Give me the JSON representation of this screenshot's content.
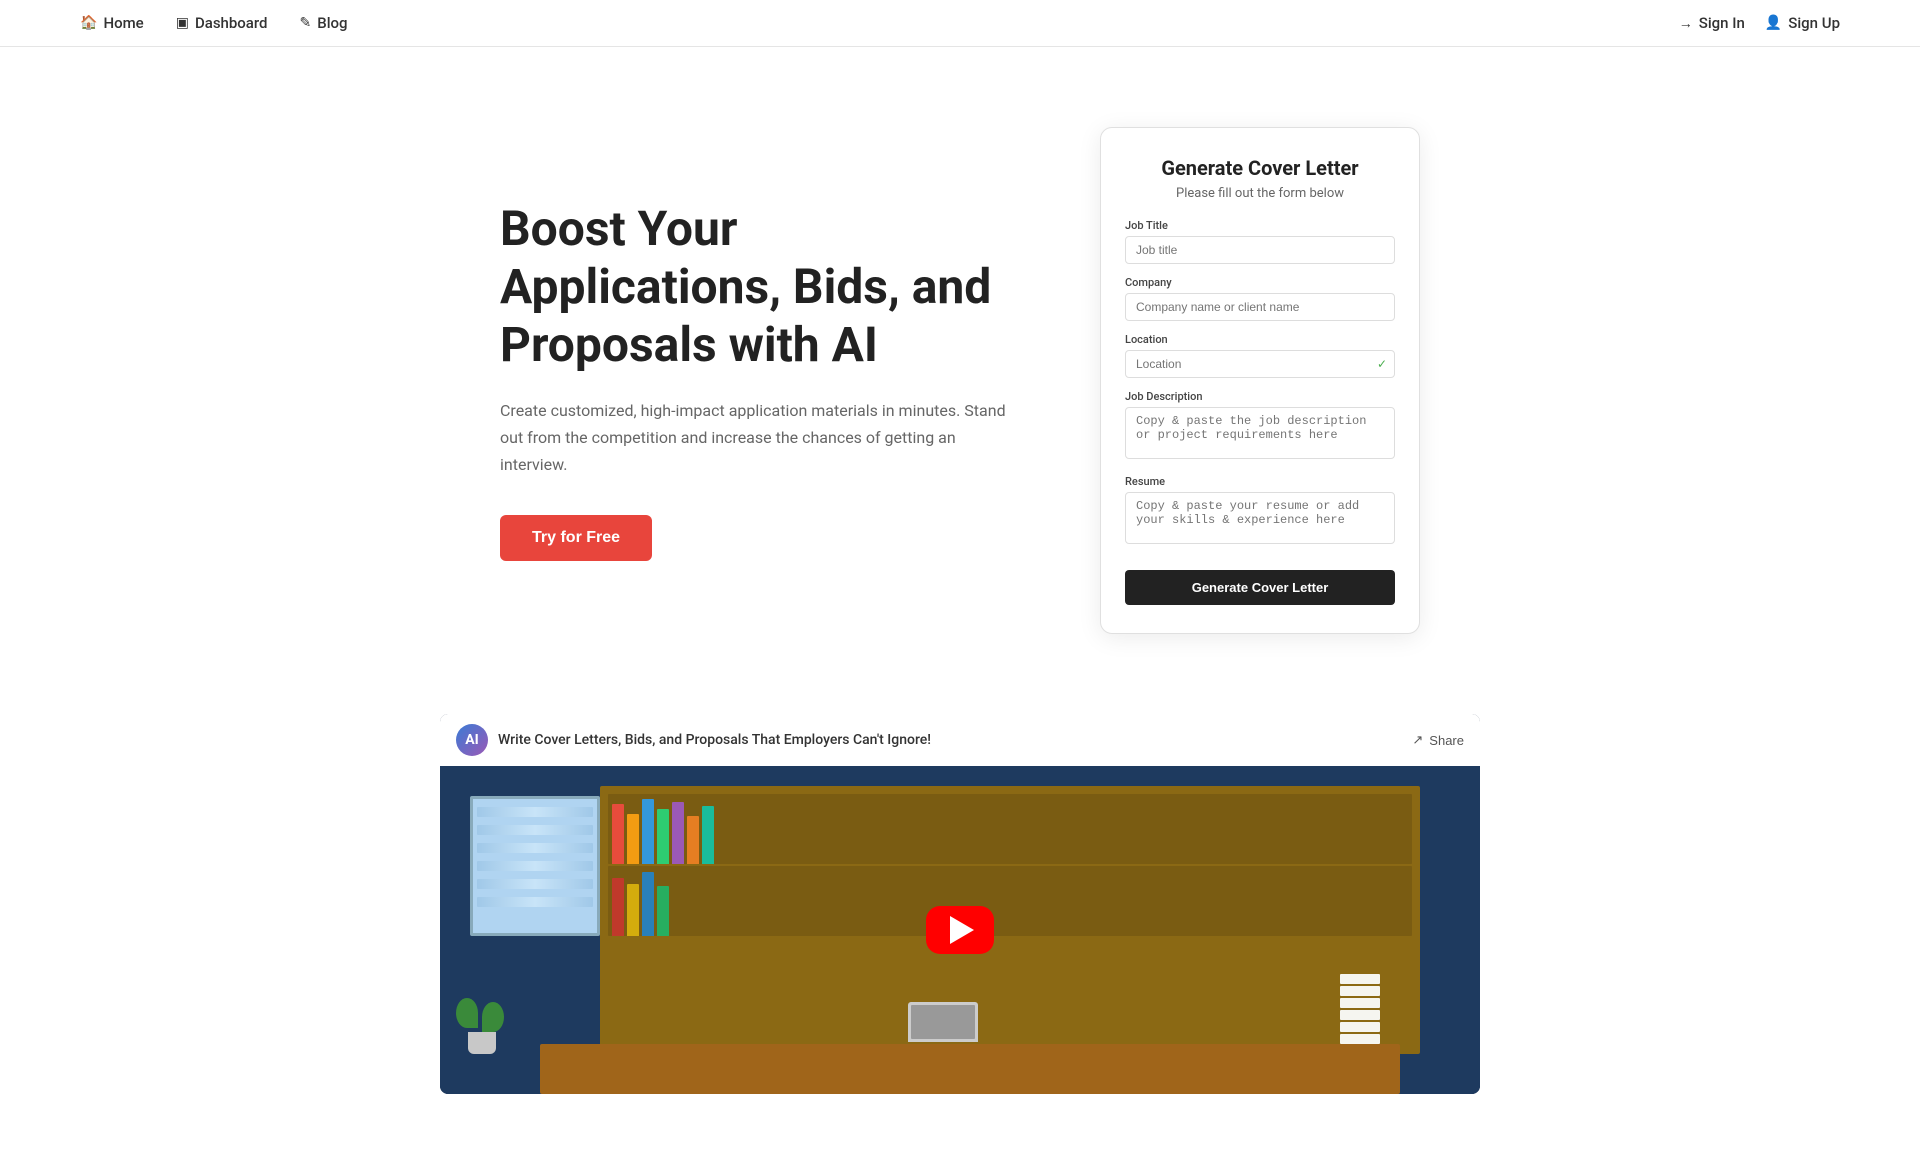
{
  "nav": {
    "links": [
      {
        "id": "home",
        "icon": "🏠",
        "label": "Home"
      },
      {
        "id": "dashboard",
        "icon": "▣",
        "label": "Dashboard"
      },
      {
        "id": "blog",
        "icon": "✎",
        "label": "Blog"
      }
    ],
    "auth": [
      {
        "id": "signin",
        "icon": "→",
        "label": "Sign In"
      },
      {
        "id": "signup",
        "icon": "👤",
        "label": "Sign Up"
      }
    ]
  },
  "hero": {
    "title": "Boost Your Applications, Bids, and Proposals with AI",
    "subtitle": "Create customized, high-impact application materials in minutes. Stand out from the competition and increase the chances of getting an interview.",
    "cta_label": "Try for Free"
  },
  "form_card": {
    "title": "Generate Cover Letter",
    "subtitle": "Please fill out the form below",
    "fields": [
      {
        "id": "job-title",
        "label": "Job Title",
        "placeholder": "Job title",
        "type": "input"
      },
      {
        "id": "company",
        "label": "Company",
        "placeholder": "Company name or client name",
        "type": "input"
      },
      {
        "id": "location",
        "label": "Location",
        "placeholder": "Location",
        "type": "input",
        "has_icon": true
      },
      {
        "id": "job-description",
        "label": "Job Description",
        "placeholder": "Copy & paste the job description or project requirements here",
        "type": "textarea"
      },
      {
        "id": "resume",
        "label": "Resume",
        "placeholder": "Copy & paste your resume or add your skills & experience here",
        "type": "textarea"
      }
    ],
    "submit_label": "Generate Cover Letter"
  },
  "video": {
    "channel_initial": "AI",
    "title": "Write Cover Letters, Bids, and Proposals That Employers Can't Ignore!",
    "share_label": "Share"
  },
  "colors": {
    "cta_bg": "#e8453c",
    "nav_border": "#e5e5e5",
    "card_shadow": "rgba(0,0,0,0.08)"
  }
}
